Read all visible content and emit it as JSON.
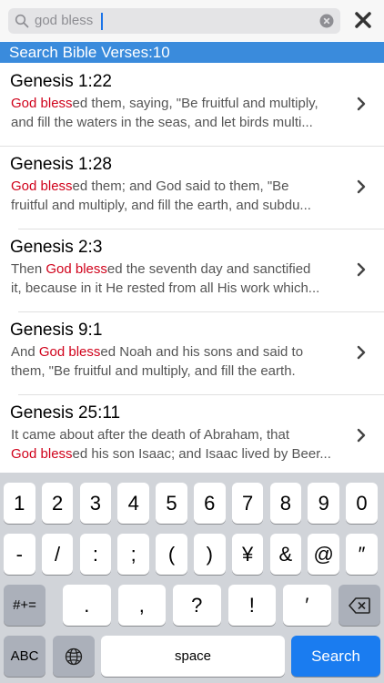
{
  "search": {
    "value": "god bless",
    "close_label": "✖"
  },
  "header": {
    "title": "Search Bible Verses:10"
  },
  "results": [
    {
      "ref": "Genesis 1:22",
      "line1": [
        {
          "t": "God bless",
          "h": true
        },
        {
          "t": "ed them, saying, \"Be fruitful and multiply,",
          "h": false
        }
      ],
      "line2": [
        {
          "t": "and fill the waters in the seas, and let birds multi...",
          "h": false
        }
      ]
    },
    {
      "ref": "Genesis 1:28",
      "line1": [
        {
          "t": "God bless",
          "h": true
        },
        {
          "t": "ed them; and God said to them, \"Be",
          "h": false
        }
      ],
      "line2": [
        {
          "t": "fruitful and multiply, and fill the earth, and subdu...",
          "h": false
        }
      ]
    },
    {
      "ref": "Genesis 2:3",
      "line1": [
        {
          "t": "Then ",
          "h": false
        },
        {
          "t": "God bless",
          "h": true
        },
        {
          "t": "ed the seventh day and sanctified",
          "h": false
        }
      ],
      "line2": [
        {
          "t": "it, because in it He rested from all His work which...",
          "h": false
        }
      ]
    },
    {
      "ref": "Genesis 9:1",
      "line1": [
        {
          "t": "And ",
          "h": false
        },
        {
          "t": "God bless",
          "h": true
        },
        {
          "t": "ed Noah and his sons and said to",
          "h": false
        }
      ],
      "line2": [
        {
          "t": "them, \"Be fruitful and multiply, and fill the earth.",
          "h": false
        }
      ]
    },
    {
      "ref": "Genesis 25:11",
      "line1": [
        {
          "t": "It came about after the death of Abraham, that",
          "h": false
        }
      ],
      "line2": [
        {
          "t": "God bless",
          "h": true
        },
        {
          "t": "ed his son Isaac; and Isaac lived by Beer...",
          "h": false
        }
      ]
    }
  ],
  "keyboard": {
    "row1": [
      "1",
      "2",
      "3",
      "4",
      "5",
      "6",
      "7",
      "8",
      "9",
      "0"
    ],
    "row2": [
      "-",
      "/",
      ":",
      ";",
      "(",
      ")",
      "¥",
      "&",
      "@",
      "″"
    ],
    "row3": [
      "#+=",
      ".",
      ",",
      "?",
      "!",
      "′"
    ],
    "row4": [
      "ABC",
      "space",
      "Search"
    ]
  },
  "colors": {
    "accent": "#3a8bdc",
    "highlight": "#d0021b",
    "search_key": "#1a7cf0"
  }
}
